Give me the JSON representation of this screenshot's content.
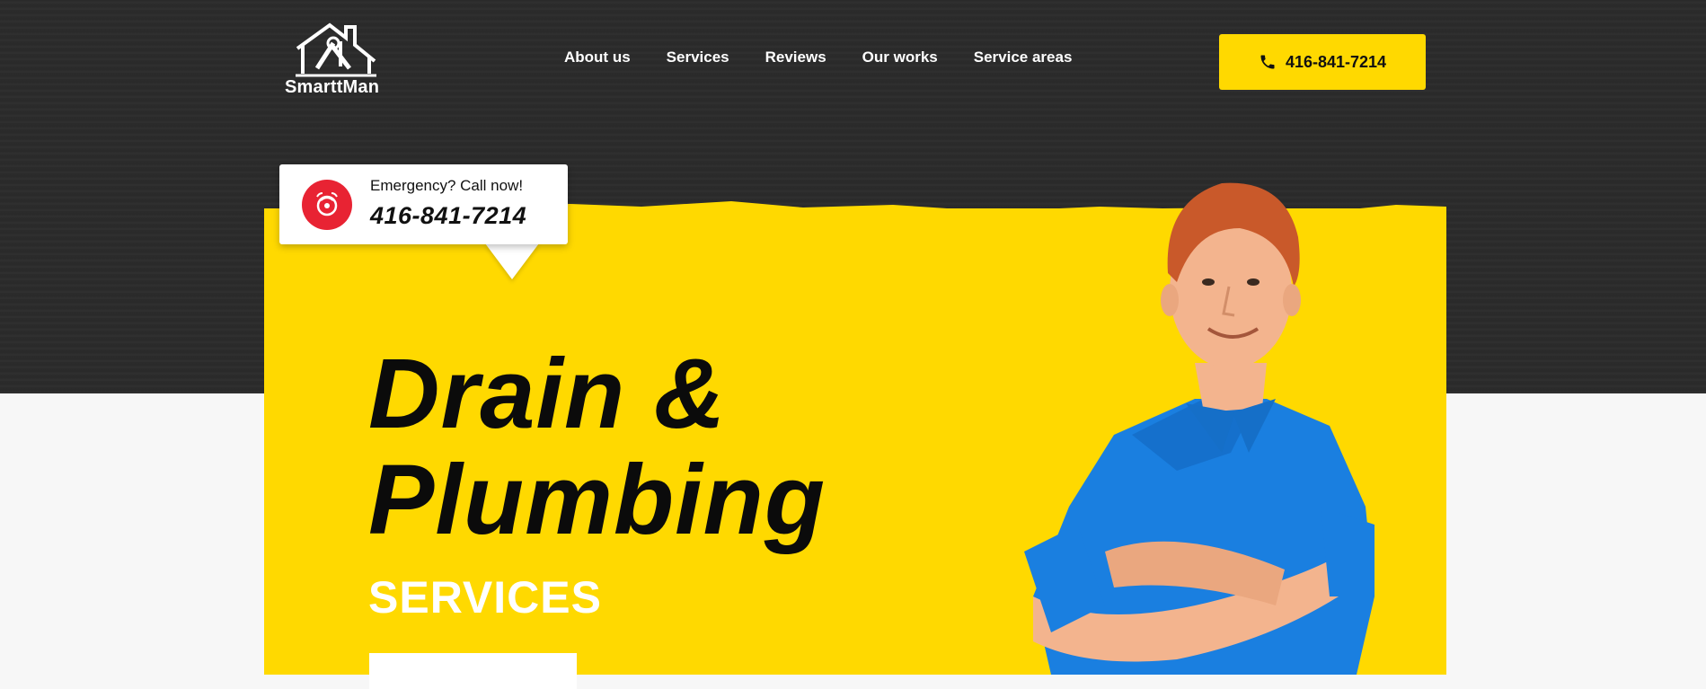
{
  "brand": {
    "name": "SmarttMan"
  },
  "nav": {
    "items": [
      {
        "label": "About us"
      },
      {
        "label": "Services"
      },
      {
        "label": "Reviews"
      },
      {
        "label": "Our works"
      },
      {
        "label": "Service areas"
      }
    ]
  },
  "header_call": {
    "phone": "416-841-7214",
    "icon": "phone-icon"
  },
  "emergency": {
    "label": "Emergency? Call now!",
    "phone": "416-841-7214",
    "icon": "alarm-icon"
  },
  "hero": {
    "title_line1": "Drain &",
    "title_line2": "Plumbing",
    "subtitle": "SERVICES"
  },
  "colors": {
    "accent": "#ffd900",
    "dark": "#2b2b2b",
    "alert": "#e82333",
    "shirt": "#1a7fe0"
  }
}
